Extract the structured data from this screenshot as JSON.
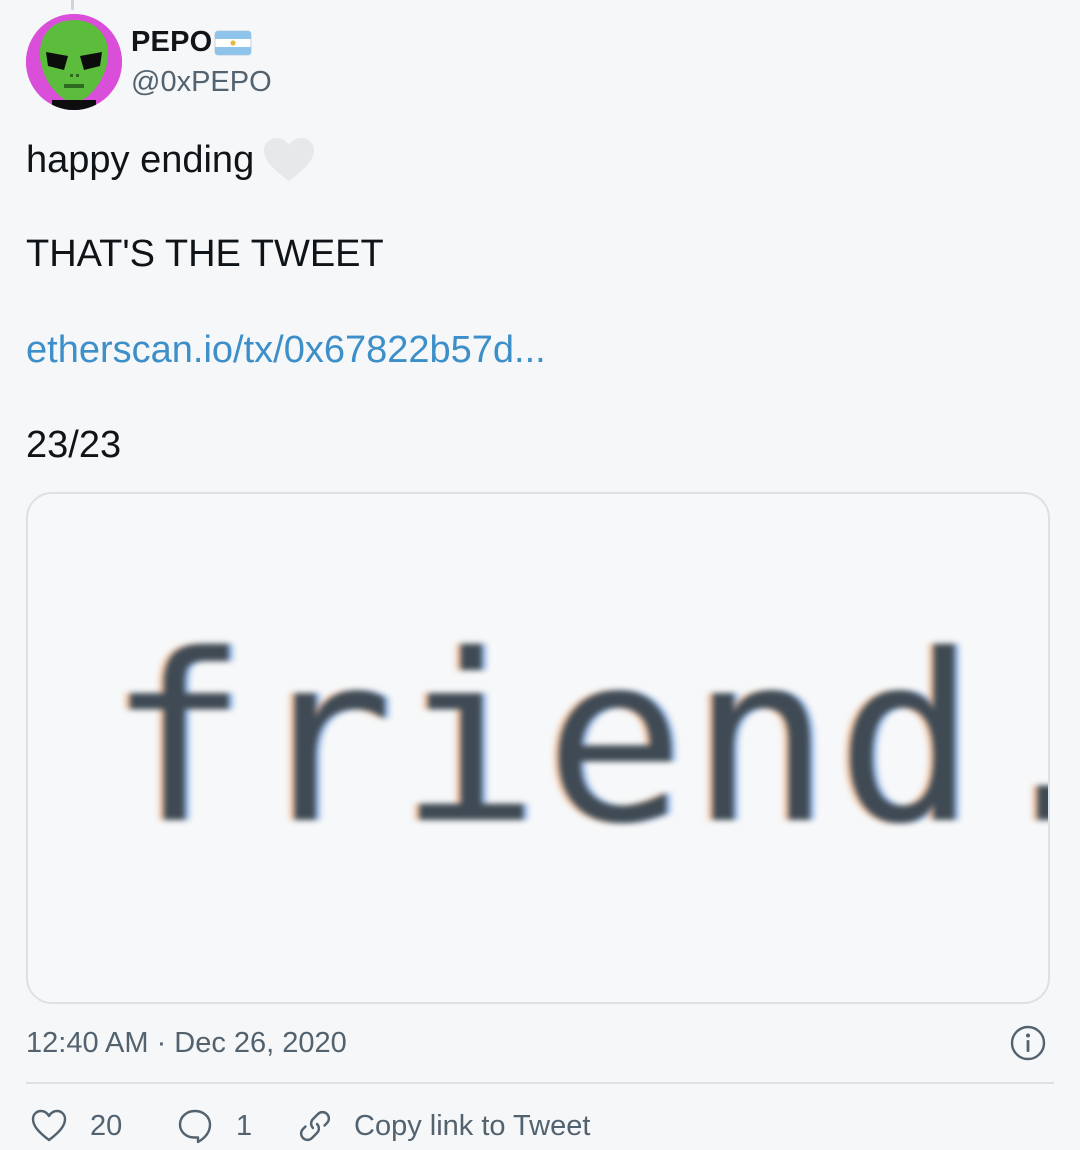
{
  "author": {
    "display_name": "PEPO",
    "flag_icon": "argentina-flag-icon",
    "handle": "@0xPEPO",
    "avatar_icon": "green-alien-avatar"
  },
  "tweet": {
    "line_1": "happy ending",
    "line_1_emoji": "white-heart-icon",
    "line_2": "THAT'S THE TWEET",
    "link": "etherscan.io/tx/0x67822b57d...",
    "line_4": "23/23",
    "media_text": "friend.",
    "timestamp": "12:40 AM · Dec 26, 2020"
  },
  "actions": {
    "like_count": "20",
    "reply_count": "1",
    "copy_link_label": "Copy link to Tweet"
  },
  "colors": {
    "background": "#f6f7f8",
    "link": "#3c8fc9",
    "muted": "#53626f",
    "avatar_bg": "#d94fd9"
  }
}
